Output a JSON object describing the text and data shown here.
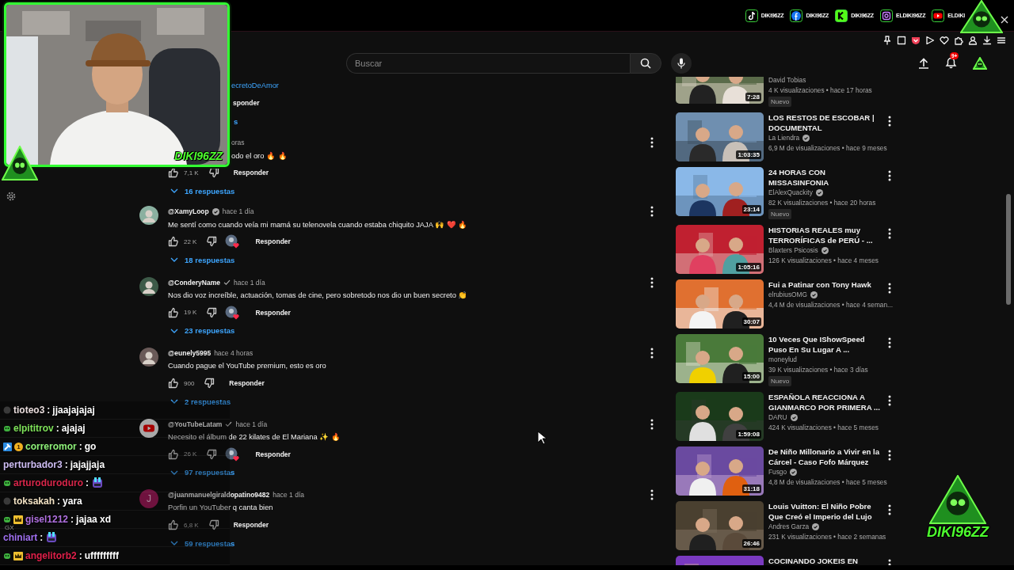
{
  "socials": [
    {
      "kind": "tiktok",
      "handle": "DIKI96ZZ"
    },
    {
      "kind": "facebook",
      "handle": "DIKI96ZZ"
    },
    {
      "kind": "kick",
      "handle": "DIKI96ZZ"
    },
    {
      "kind": "instagram",
      "handle": "ELDIKI96ZZ"
    },
    {
      "kind": "youtube",
      "handle": "ELDIKI"
    }
  ],
  "webcam": {
    "label": "DIKI96ZZ"
  },
  "header": {
    "search": {
      "placeholder": "Buscar"
    },
    "notifications": {
      "badge": "9+"
    }
  },
  "comments": [
    {
      "kind": "clipped_top",
      "text": "ecretoDeAmor",
      "reply_label": "sponder",
      "replies": "s"
    },
    {
      "kind": "clipped_head",
      "time": "oras",
      "text": "odo el oro 🔥 🔥",
      "likes": "7,1 K",
      "hearted": false,
      "reply_label": "Responder",
      "replies": "16 respuestas"
    },
    {
      "kind": "full",
      "author": "@XamyLoop",
      "author_badge": {
        "kind": "verified"
      },
      "time": "hace 1 día",
      "text": "Me sentí como cuando veía mi mamá su telenovela cuando estaba chiquito JAJA 🙌 ❤️ 🔥",
      "likes": "22 K",
      "hearted": true,
      "reply_label": "Responder",
      "replies": "18 respuestas"
    },
    {
      "kind": "full",
      "author": "@ConderyName",
      "author_badge": {
        "kind": "check"
      },
      "time": "hace 1 día",
      "text": "Nos dio voz increíble, actuación, tomas de cine, pero sobretodo nos dio un buen secreto 👏",
      "likes": "19 K",
      "hearted": true,
      "reply_label": "Responder",
      "replies": "23 respuestas"
    },
    {
      "kind": "full",
      "author": "@eunely5995",
      "time": "hace 4 horas",
      "text": "Cuando pague el YouTube premium, esto es oro",
      "likes": "900",
      "hearted": false,
      "reply_label": "Responder",
      "replies": "2 respuestas"
    },
    {
      "kind": "full",
      "avatar": {
        "kind": "logo"
      },
      "author": "@YouTubeLatam",
      "author_badge": {
        "kind": "check"
      },
      "time": "hace 1 día",
      "text": "Necesito el álbum de 22 kilates de El Mariana ✨ 🔥",
      "likes": "26 K",
      "hearted": true,
      "reply_label": "Responder",
      "replies": "97 respuestas"
    },
    {
      "kind": "full",
      "avatar": {
        "kind": "letter",
        "letter": "J"
      },
      "author": "@juanmanuelgiraldopatino9482",
      "time": "hace 1 día",
      "text": "Porfin un YouTuber q canta bien",
      "likes": "6,8 K",
      "hearted": false,
      "reply_label": "Responder",
      "replies": "59 respuestas"
    }
  ],
  "chat": [
    {
      "kind": "text",
      "name": "tioteo3",
      "color": "#e8dcdc",
      "badges": [
        {
          "kind": "dot"
        }
      ],
      "separator": ":",
      "message": "jjaajajajaj"
    },
    {
      "kind": "text",
      "name": "elpititrov",
      "color": "#7fe35a",
      "badges": [
        {
          "kind": "green"
        }
      ],
      "separator": ":",
      "message": "ajajaj"
    },
    {
      "kind": "text",
      "name": "correromor",
      "color": "#8ff27a",
      "badges": [
        {
          "kind": "hammer"
        },
        {
          "kind": "coin",
          "label": "1"
        }
      ],
      "separator": ":",
      "message": "go"
    },
    {
      "kind": "text",
      "name": "perturbador3",
      "color": "#cdbcf2",
      "separator": ":",
      "message": "jajajjaja"
    },
    {
      "kind": "emote",
      "name": "arturoduroduro",
      "color": "#d8264a",
      "badges": [
        {
          "kind": "green"
        }
      ],
      "separator": ":"
    },
    {
      "kind": "text",
      "name": "toksakah",
      "color": "#f2e2c4",
      "badges": [
        {
          "kind": "dot"
        }
      ],
      "separator": ":",
      "message": "yara"
    },
    {
      "kind": "text",
      "name": "gisel1212",
      "color": "#b070e0",
      "badges": [
        {
          "kind": "green"
        },
        {
          "kind": "crown"
        }
      ],
      "separator": ":",
      "message": "jajaa xd"
    },
    {
      "kind": "emote",
      "name": "chiniart",
      "color": "#a070f0",
      "tag": "GX",
      "separator": ":"
    },
    {
      "kind": "text",
      "name": "angelitorb2",
      "color": "#e0204a",
      "badges": [
        {
          "kind": "green"
        },
        {
          "kind": "crown"
        }
      ],
      "separator": ":",
      "message": "ufffffffff"
    }
  ],
  "related": [
    {
      "kind": "clipped",
      "channel": "David Tobias",
      "verified": false,
      "meta": "4 K visualizaciones • hace 17 horas",
      "new_label": "Nuevo",
      "duration": "7:28"
    },
    {
      "kind": "full",
      "title": "LOS RESTOS DE ESCOBAR | DOCUMENTAL",
      "channel": "La Liendra",
      "verified": true,
      "meta": "6,9 M de visualizaciones • hace 9 meses",
      "duration": "1:03:35"
    },
    {
      "kind": "full",
      "title": "24 HORAS CON MISSASINFONIA",
      "channel": "ElAlexQuackity",
      "verified": true,
      "meta": "82 K visualizaciones • hace 20 horas",
      "new_label": "Nuevo",
      "duration": "23:14"
    },
    {
      "kind": "full",
      "title": "HISTORIAS REALES muy TERRORÍFICAS de PERÚ - ...",
      "channel": "Blaxters Psicosis",
      "verified": true,
      "meta": "126 K visualizaciones • hace 4 meses",
      "duration": "1:05:16"
    },
    {
      "kind": "full",
      "title": "Fui a Patinar con Tony Hawk",
      "channel": "elrubiusOMG",
      "verified": true,
      "meta": "4,4 M de visualizaciones • hace 4 seman...",
      "duration": "30:07"
    },
    {
      "kind": "full",
      "title": "10 Veces Que IShowSpeed Puso En Su Lugar A ...",
      "channel": "moneylud",
      "verified": false,
      "meta": "39 K visualizaciones • hace 3 días",
      "new_label": "Nuevo",
      "duration": "15:00"
    },
    {
      "kind": "full",
      "title": "ESPAÑOLA REACCIONA A GIANMARCO POR PRIMERA ...",
      "channel": "DARU",
      "verified": true,
      "meta": "424 K visualizaciones • hace 5 meses",
      "duration": "1:59:08"
    },
    {
      "kind": "full",
      "title": "De Niño Millonario a Vivir en la Cárcel - Caso Fofo Márquez",
      "channel": "Fusgo",
      "verified": true,
      "meta": "4,8 M de visualizaciones • hace 5 meses",
      "duration": "31:18"
    },
    {
      "kind": "full",
      "title": "Louis Vuitton: El Niño Pobre Que Creó el Imperio del Lujo",
      "channel": "Andres Garza",
      "verified": true,
      "meta": "231 K visualizaciones • hace 2 semanas",
      "duration": "26:46"
    },
    {
      "kind": "cut",
      "title": "COCINANDO JOKEIS EN"
    }
  ],
  "stream_logo": {
    "label": "DIKI96ZZ"
  }
}
